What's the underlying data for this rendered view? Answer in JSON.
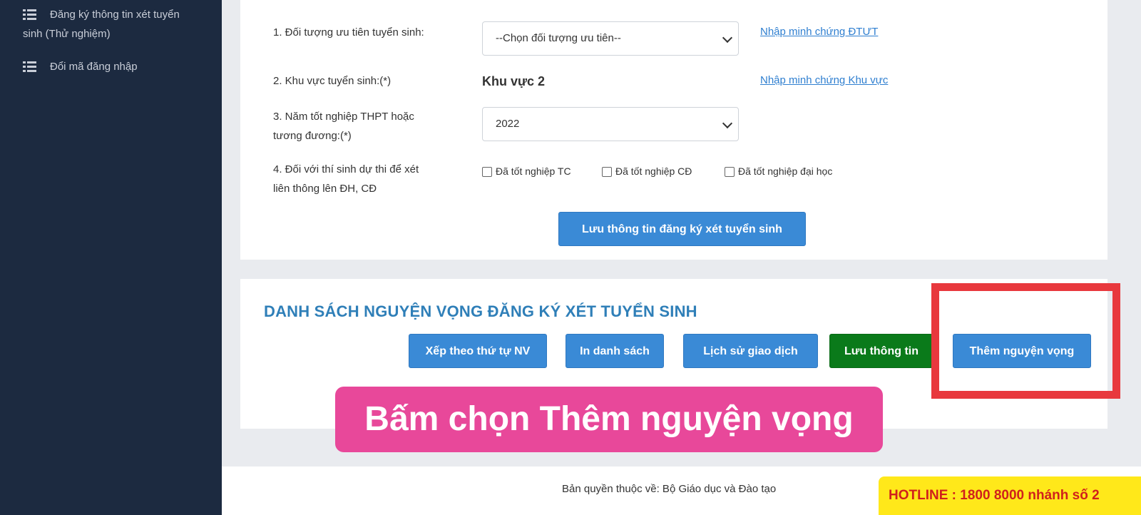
{
  "sidebar": {
    "items": [
      {
        "label": "Đăng ký thông tin xét tuyển sinh (Thử nghiệm)",
        "icon": "list-icon"
      },
      {
        "label": "Đổi mã đăng nhập",
        "icon": "list-icon"
      }
    ]
  },
  "form": {
    "priority": {
      "label": "1. Đối tượng ưu tiên tuyển sinh:",
      "selected": "--Chọn đối tượng ưu tiên--",
      "link": "Nhập minh chứng ĐTƯT"
    },
    "region": {
      "label": "2. Khu vực tuyển sinh:(*)",
      "value": "Khu vực 2",
      "link": "Nhập minh chứng Khu vực"
    },
    "grad_year": {
      "label_line1": "3. Năm tốt nghiệp THPT hoặc",
      "label_line2": "tương đương:(*)",
      "selected": "2022"
    },
    "transfer": {
      "label_line1": "4. Đối với thí sinh dự thi để xét",
      "label_line2": "liên thông lên ĐH, CĐ",
      "options": [
        "Đã tốt nghiệp TC",
        "Đã tốt nghiệp CĐ",
        "Đã tốt nghiệp đại học"
      ]
    },
    "save_button": "Lưu thông tin đăng ký xét tuyển sinh"
  },
  "wishlist": {
    "title": "DANH SÁCH NGUYỆN VỌNG ĐĂNG KÝ XÉT TUYỂN SINH",
    "buttons": {
      "sort": "Xếp theo thứ tự NV",
      "print": "In danh sách",
      "history": "Lịch sử giao dịch",
      "save": "Lưu thông tin",
      "add": "Thêm nguyện vọng"
    }
  },
  "callout": "Bấm chọn Thêm nguyện vọng",
  "footer": {
    "copyright": "Bản quyền thuộc về: Bộ Giáo dục và Đào tạo",
    "hotline": "HOTLINE : 1800 8000 nhánh số 2"
  },
  "colors": {
    "sidebar_bg": "#1c2a40",
    "primary_button": "#3a8ad6",
    "green_button": "#0a7a1a",
    "highlight_red": "#e8383d",
    "callout_pink": "#e8489a",
    "hotline_yellow": "#ffe81a"
  }
}
